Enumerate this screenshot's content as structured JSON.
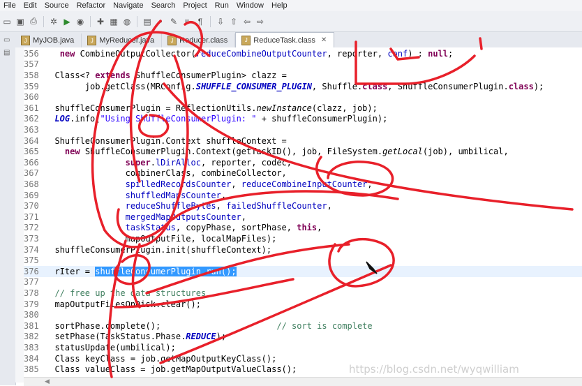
{
  "menu": [
    "File",
    "Edit",
    "Source",
    "Refactor",
    "Navigate",
    "Search",
    "Project",
    "Run",
    "Window",
    "Help"
  ],
  "tabs": [
    {
      "label": "MyJOB.java",
      "icon": "java-file-icon"
    },
    {
      "label": "MyReducer.java",
      "icon": "java-file-icon"
    },
    {
      "label": "Reducer.class",
      "icon": "class-file-icon"
    },
    {
      "label": "ReduceTask.class",
      "icon": "class-file-icon",
      "active": true,
      "close": "✕"
    }
  ],
  "editor": {
    "lines": [
      {
        "no": "356",
        "html": "   <span class=\"kw\">new</span> CombineOutputCollector(<span class=\"fld\">reduceCombineOutputCounter</span>, reporter, <span class=\"fld\">conf</span>) : <span class=\"kw\">null</span>;"
      },
      {
        "no": "357",
        "html": ""
      },
      {
        "no": "358",
        "html": "  Class&lt;? <span class=\"kw\">extends</span> ShuffleConsumerPlugin&gt; clazz ="
      },
      {
        "no": "359",
        "html": "        job.getClass(MRConfig.<span class=\"cst\">SHUFFLE_CONSUMER_PLUGIN</span>, Shuffle.<span class=\"kw\">class</span>, ShuffleConsumerPlugin.<span class=\"kw\">class</span>);"
      },
      {
        "no": "360",
        "html": ""
      },
      {
        "no": "361",
        "html": "  shuffleConsumerPlugin = ReflectionUtils.<span class=\"itl\">newInstance</span>(clazz, job);"
      },
      {
        "no": "362",
        "html": "  <span class=\"cst\">LOG</span>.info(<span class=\"str\">\"Using ShuffleConsumerPlugin: \"</span> + shuffleConsumerPlugin);"
      },
      {
        "no": "363",
        "html": ""
      },
      {
        "no": "364",
        "html": "  ShuffleConsumerPlugin.Context shuffleContext ="
      },
      {
        "no": "365",
        "html": "    <span class=\"kw\">new</span> ShuffleConsumerPlugin.Context(getTaskID(), job, FileSystem.<span class=\"itl\">getLocal</span>(job), umbilical,"
      },
      {
        "no": "366",
        "html": "                <span class=\"kw\">super</span>.<span class=\"fld\">lDirAlloc</span>, reporter, codec,"
      },
      {
        "no": "367",
        "html": "                combinerClass, combineCollector,"
      },
      {
        "no": "368",
        "html": "                <span class=\"fld\">spilledRecordsCounter</span>, <span class=\"fld\">reduceCombineInputCounter</span>,"
      },
      {
        "no": "369",
        "html": "                <span class=\"fld\">shuffledMapsCounter</span>,"
      },
      {
        "no": "370",
        "html": "                <span class=\"fld\">reduceShuffleBytes</span>, <span class=\"fld\">failedShuffleCounter</span>,"
      },
      {
        "no": "371",
        "html": "                <span class=\"fld\">mergedMapOutputsCounter</span>,"
      },
      {
        "no": "372",
        "html": "                <span class=\"fld\">taskStatus</span>, copyPhase, sortPhase, <span class=\"kw\">this</span>,"
      },
      {
        "no": "373",
        "html": "                mapOutputFile, localMapFiles);"
      },
      {
        "no": "374",
        "html": "  shuffleConsumerPlugin.init(shuffleContext);"
      },
      {
        "no": "375",
        "html": ""
      },
      {
        "no": "376",
        "html": "  rIter = <span class=\"sel\">shuffleConsumerPlugin.run();</span>",
        "hl": true
      },
      {
        "no": "377",
        "html": ""
      },
      {
        "no": "378",
        "html": "  <span class=\"com\">// free up the data structures</span>"
      },
      {
        "no": "379",
        "html": "  mapOutputFilesOnDisk.clear();"
      },
      {
        "no": "380",
        "html": ""
      },
      {
        "no": "381",
        "html": "  sortPhase.complete();                       <span class=\"com\">// sort is complete</span>"
      },
      {
        "no": "382",
        "html": "  setPhase(TaskStatus.Phase.<span class=\"cst\">REDUCE</span>);"
      },
      {
        "no": "383",
        "html": "  statusUpdate(umbilical);"
      },
      {
        "no": "384",
        "html": "  Class keyClass = job.getMapOutputKeyClass();"
      },
      {
        "no": "385",
        "html": "  Class valueClass = job.getMapOutputValueClass();"
      }
    ]
  },
  "watermark": "https://blog.csdn.net/wyqwilliam",
  "colors": {
    "annotation": "#e8202a",
    "selection": "#3399ff",
    "keyword": "#7f0055",
    "field": "#0000c0"
  }
}
